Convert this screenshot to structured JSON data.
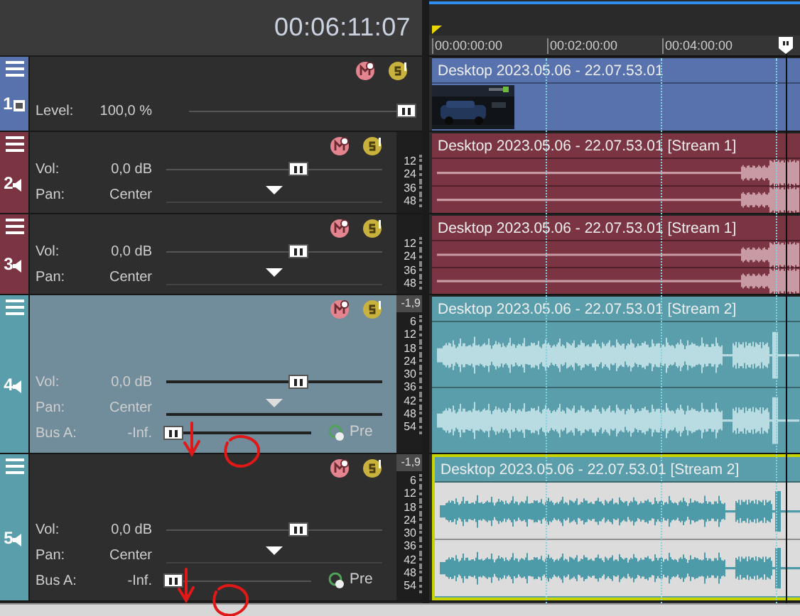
{
  "timecode": "00:06:11:07",
  "ruler": [
    "00:00:00:00",
    "00:02:00:00",
    "00:04:00:00"
  ],
  "tracks": [
    {
      "number": "1",
      "kind": "video",
      "color": "#5872ad",
      "selected": false,
      "controls": [
        {
          "kind": "slider",
          "label": "Level:",
          "value": "100,0 %",
          "level": 1.0
        }
      ],
      "event": {
        "title": "Desktop 2023.05.06 - 22.07.53.01",
        "selected": false
      }
    },
    {
      "number": "2",
      "kind": "audio",
      "color": "#7b3442",
      "selected": false,
      "meter": {
        "scale": [
          "12",
          "24",
          "36",
          "48"
        ]
      },
      "controls": [
        {
          "kind": "slider",
          "label": "Vol:",
          "value": "0,0 dB",
          "level": 0.62
        },
        {
          "kind": "pan",
          "label": "Pan:",
          "value": "Center",
          "level": 0.5
        }
      ],
      "event": {
        "title": "Desktop 2023.05.06 - 22.07.53.01 [Stream 1]",
        "selected": false
      }
    },
    {
      "number": "3",
      "kind": "audio",
      "color": "#7b3442",
      "selected": false,
      "meter": {
        "scale": [
          "12",
          "24",
          "36",
          "48"
        ]
      },
      "controls": [
        {
          "kind": "slider",
          "label": "Vol:",
          "value": "0,0 dB",
          "level": 0.62
        },
        {
          "kind": "pan",
          "label": "Pan:",
          "value": "Center",
          "level": 0.5
        }
      ],
      "event": {
        "title": "Desktop 2023.05.06 - 22.07.53.01 [Stream 1]",
        "selected": false
      }
    },
    {
      "number": "4",
      "kind": "audio",
      "color": "#5b9eab",
      "selected": true,
      "meter": {
        "peak": "-1,9",
        "scale": [
          "6",
          "12",
          "18",
          "24",
          "30",
          "36",
          "42",
          "48",
          "54"
        ]
      },
      "controls": [
        {
          "kind": "slider",
          "label": "Vol:",
          "value": "0,0 dB",
          "level": 0.62
        },
        {
          "kind": "pan",
          "label": "Pan:",
          "value": "Center",
          "level": 0.5
        },
        {
          "kind": "bus",
          "label": "Bus A:",
          "value": "-Inf.",
          "level": 0,
          "mode": "Pre"
        }
      ],
      "event": {
        "title": "Desktop 2023.05.06 - 22.07.53.01 [Stream 2]",
        "selected": false
      }
    },
    {
      "number": "5",
      "kind": "audio",
      "color": "#5b9eab",
      "selected": false,
      "meter": {
        "peak": "-1,9",
        "scale": [
          "6",
          "12",
          "18",
          "24",
          "30",
          "36",
          "42",
          "48",
          "54"
        ]
      },
      "controls": [
        {
          "kind": "slider",
          "label": "Vol:",
          "value": "0,0 dB",
          "level": 0.62
        },
        {
          "kind": "pan",
          "label": "Pan:",
          "value": "Center",
          "level": 0.5
        },
        {
          "kind": "bus",
          "label": "Bus A:",
          "value": "-Inf.",
          "level": 0,
          "mode": "Pre"
        }
      ],
      "event": {
        "title": "Desktop 2023.05.06 - 22.07.53.01 [Stream 2]",
        "selected": true
      }
    }
  ],
  "annotations": [
    {
      "kind": "arrow"
    },
    {
      "kind": "circle"
    },
    {
      "kind": "arrow"
    },
    {
      "kind": "circle"
    }
  ]
}
